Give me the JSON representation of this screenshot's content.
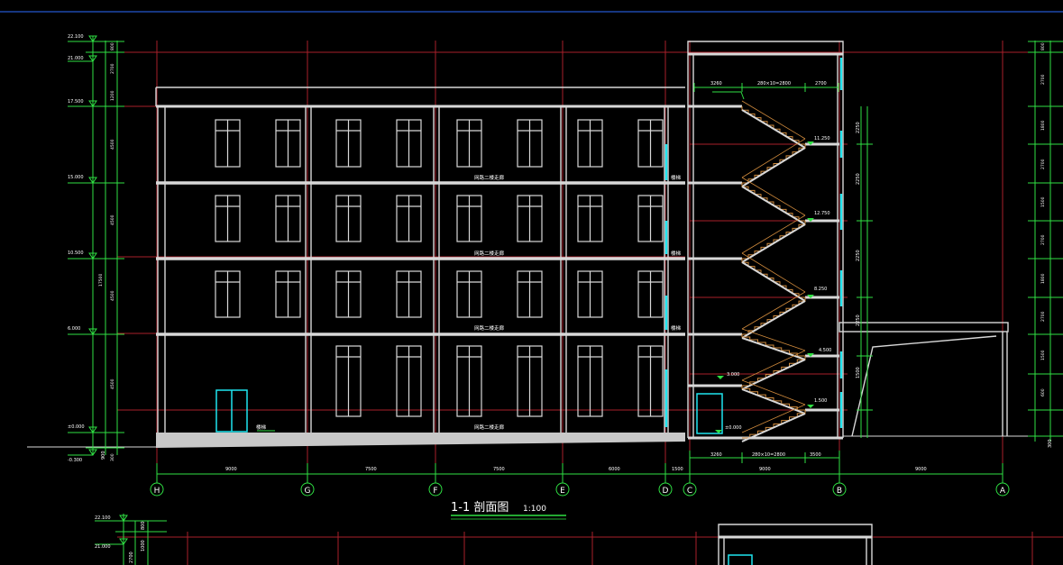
{
  "theme": {
    "background": "#000000",
    "building_line": "#d8d8d8",
    "axis_red": "#a8202a",
    "dimension_green": "#2fe043",
    "glazing_cyan": "#1fe6f0",
    "stair_orange": "#d08a3c",
    "text_white": "#ffffff",
    "top_rule_blue": "#2c6cff"
  },
  "drawing": {
    "title": "1-1   剖面图",
    "scale": "1:100",
    "room_label": "网路二楼走廊",
    "stair_label": "楼梯",
    "left_elevations": [
      "22.100",
      "21.000",
      "17.500",
      "15.000",
      "10.500",
      "6.000",
      "±0.000",
      "-0.300"
    ],
    "left_dims": [
      "800",
      "2700",
      "1200",
      "4500",
      "4500",
      "4500",
      "4500",
      "300",
      "17500"
    ],
    "stair_elevations": [
      "11.250",
      "12.750",
      "8.250",
      "4.500",
      "3.000",
      "1.500",
      "±0.000"
    ],
    "stair_top_dims": [
      "3260",
      "280×10=2800",
      "2700"
    ],
    "stair_side_dims": [
      "2250",
      "2250",
      "2250",
      "2250",
      "1500"
    ],
    "right_dims": [
      "800",
      "2700",
      "1800",
      "2700",
      "1500",
      "2700",
      "1800",
      "2700",
      "1500",
      "600"
    ],
    "grid_axes": [
      "H",
      "G",
      "F",
      "E",
      "D",
      "C",
      "B",
      "A"
    ],
    "bottom_dims": [
      "9000",
      "7500",
      "7500",
      "6000",
      "1500",
      "3260",
      "280×10=2800",
      "3500",
      "9000",
      "9000"
    ],
    "base_dims": [
      "300",
      "900"
    ],
    "partial_elevations": [
      "22.100",
      "21.000"
    ],
    "partial_dims": [
      "800",
      "1000",
      "2700"
    ]
  }
}
